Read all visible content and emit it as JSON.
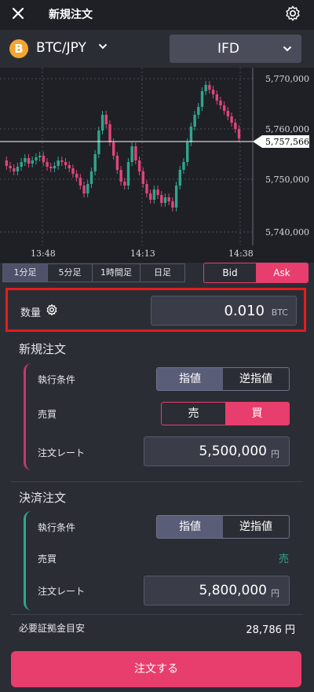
{
  "header": {
    "title": "新規注文"
  },
  "pair": {
    "symbol": "B",
    "name": "BTC/JPY"
  },
  "order_type": {
    "selected": "IFD"
  },
  "chart_data": {
    "type": "candlestick",
    "price_ticks": [
      "5,770,000",
      "5,760,000",
      "5,750,000",
      "5,740,000"
    ],
    "current_price": "5,757,566",
    "time_ticks": [
      "13:48",
      "14:13",
      "14:38"
    ]
  },
  "timeframes": [
    {
      "label": "1分足",
      "active": true
    },
    {
      "label": "5分足",
      "active": false
    },
    {
      "label": "1時間足",
      "active": false
    },
    {
      "label": "日足",
      "active": false
    }
  ],
  "bid_ask": {
    "bid": "Bid",
    "ask": "Ask",
    "active": "Ask"
  },
  "quantity": {
    "label": "数量",
    "value": "0.010",
    "unit": "BTC"
  },
  "new_order": {
    "title": "新規注文",
    "exec_label": "執行条件",
    "exec_options": [
      "指値",
      "逆指値"
    ],
    "side_label": "売買",
    "side_options": [
      "売",
      "買"
    ],
    "rate_label": "注文レート",
    "rate_value": "5,500,000",
    "rate_unit": "円"
  },
  "settle_order": {
    "title": "決済注文",
    "exec_label": "執行条件",
    "exec_options": [
      "指値",
      "逆指値"
    ],
    "side_label": "売買",
    "side_value": "売",
    "rate_label": "注文レート",
    "rate_value": "5,800,000",
    "rate_unit": "円"
  },
  "margin": {
    "label": "必要証拠金目安",
    "value": "28,786 円"
  },
  "submit": {
    "label": "注文する"
  },
  "colors": {
    "accent": "#e83e6d",
    "green": "#2fa68c",
    "btc": "#f2a531"
  }
}
